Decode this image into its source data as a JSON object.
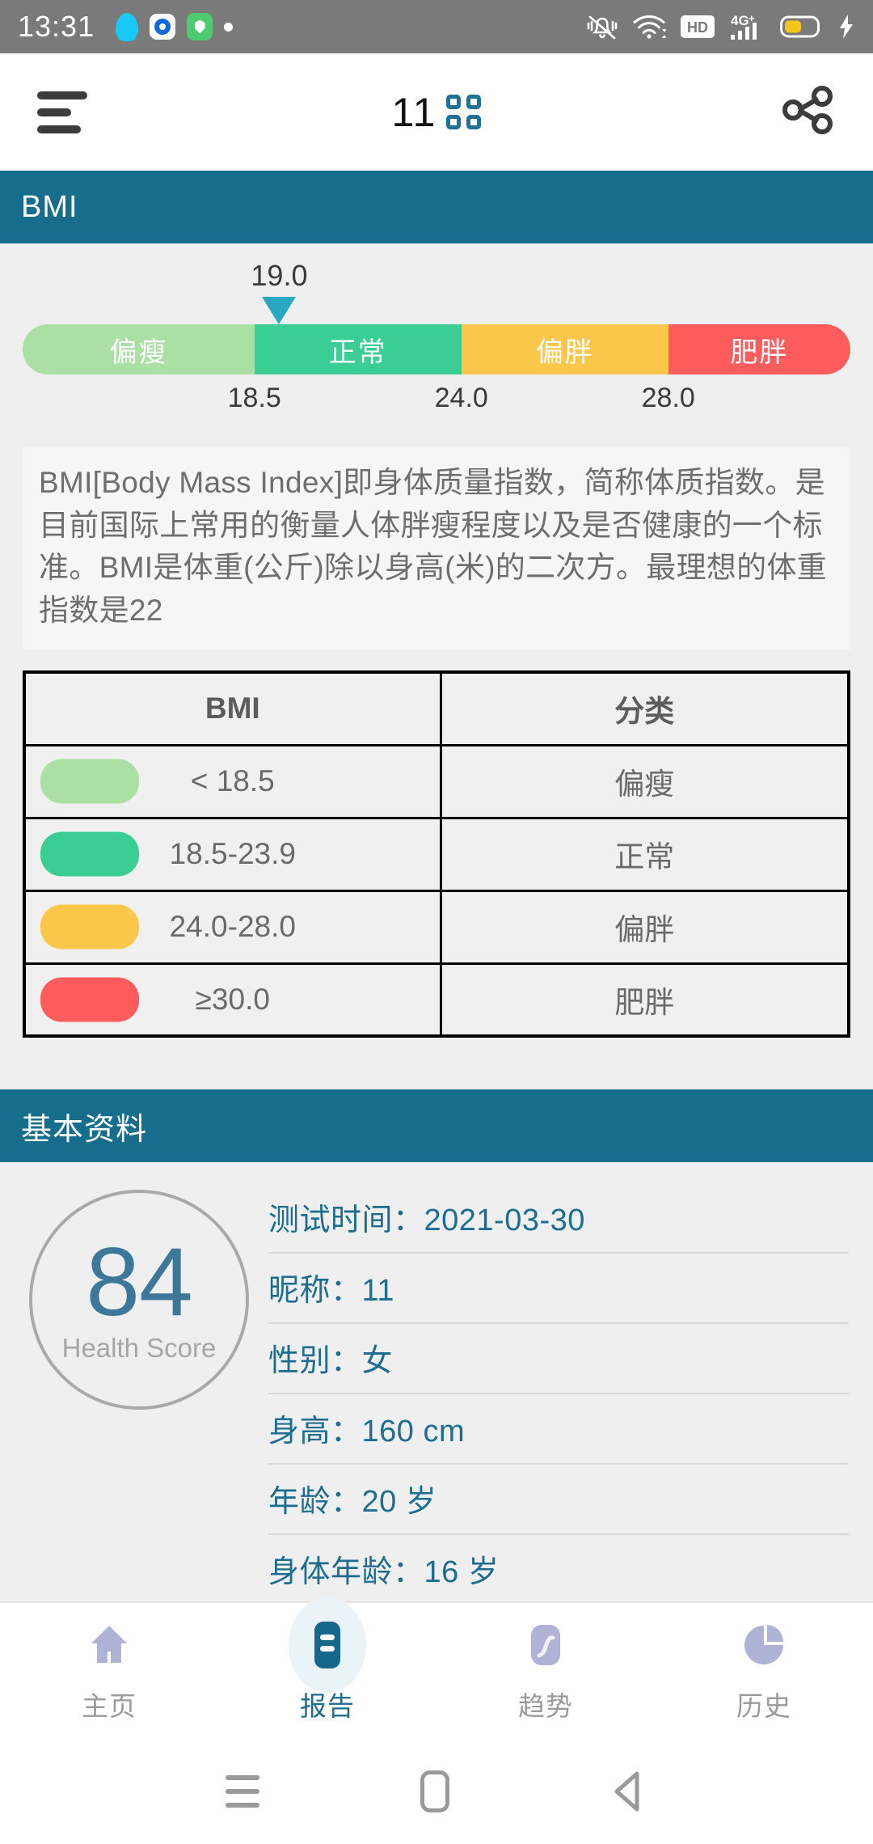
{
  "status_bar": {
    "time": "13:31",
    "left_icons": [
      "qq-penguin-icon",
      "eye-app-icon",
      "shield-app-icon",
      "dot-indicator"
    ],
    "right_icons": [
      "mute-bell-icon",
      "wifi-icon",
      "hd-icon",
      "4g-plus-signal-icon",
      "battery-icon",
      "charging-bolt-icon"
    ],
    "hd_label": "HD",
    "network_label": "4G",
    "network_plus": "+"
  },
  "app_bar": {
    "menu_icon": "hamburger-menu-icon",
    "title": "11",
    "title_icon": "grid-qr-icon",
    "share_icon": "share-icon"
  },
  "bmi_section": {
    "header": "BMI",
    "gauge": {
      "marker_value": "19.0",
      "marker_color": "#29A8C4",
      "segments": [
        {
          "label": "偏瘦",
          "color": "#ABE0A5",
          "width_pct": 28
        },
        {
          "label": "正常",
          "color": "#3ACE95",
          "width_pct": 25
        },
        {
          "label": "偏胖",
          "color": "#FBC74A",
          "width_pct": 25
        },
        {
          "label": "肥胖",
          "color": "#FC5C5C",
          "width_pct": 22
        }
      ],
      "boundaries": [
        {
          "value": "18.5",
          "pos_pct": 28
        },
        {
          "value": "24.0",
          "pos_pct": 53
        },
        {
          "value": "28.0",
          "pos_pct": 78
        }
      ],
      "marker_pos_pct": 31
    },
    "description": "BMI[Body Mass Index]即身体质量指数，简称体质指数。是目前国际上常用的衡量人体胖瘦程度以及是否健康的一个标准。BMI是体重(公斤)除以身高(米)的二次方。最理想的体重指数是22",
    "table": {
      "headers": [
        "BMI",
        "分类"
      ],
      "rows": [
        {
          "color": "#ABE0A5",
          "range": "< 18.5",
          "category": "偏瘦"
        },
        {
          "color": "#3ACE95",
          "range": "18.5-23.9",
          "category": "正常"
        },
        {
          "color": "#FBC74A",
          "range": "24.0-28.0",
          "category": "偏胖"
        },
        {
          "color": "#FC5C5C",
          "range": "≥30.0",
          "category": "肥胖"
        }
      ]
    }
  },
  "basic_section": {
    "header": "基本资料",
    "score": {
      "value": "84",
      "label": "Health Score"
    },
    "rows": [
      "测试时间：2021-03-30",
      "昵称：11",
      "性别：女",
      "身高：160 cm",
      "年龄：20 岁",
      "身体年龄：16 岁"
    ]
  },
  "bottom_nav": {
    "items": [
      {
        "label": "主页",
        "icon": "home-icon",
        "active": false
      },
      {
        "label": "报告",
        "icon": "report-icon",
        "active": true
      },
      {
        "label": "趋势",
        "icon": "trend-icon",
        "active": false
      },
      {
        "label": "历史",
        "icon": "history-pie-icon",
        "active": false
      }
    ]
  },
  "system_nav": {
    "recents_icon": "recents-icon",
    "home_icon": "home-square-icon",
    "back_icon": "back-triangle-icon"
  },
  "colors": {
    "section_header": "#166E8C",
    "accent": "#1D6D91",
    "page_bg": "#EFEFEF"
  }
}
